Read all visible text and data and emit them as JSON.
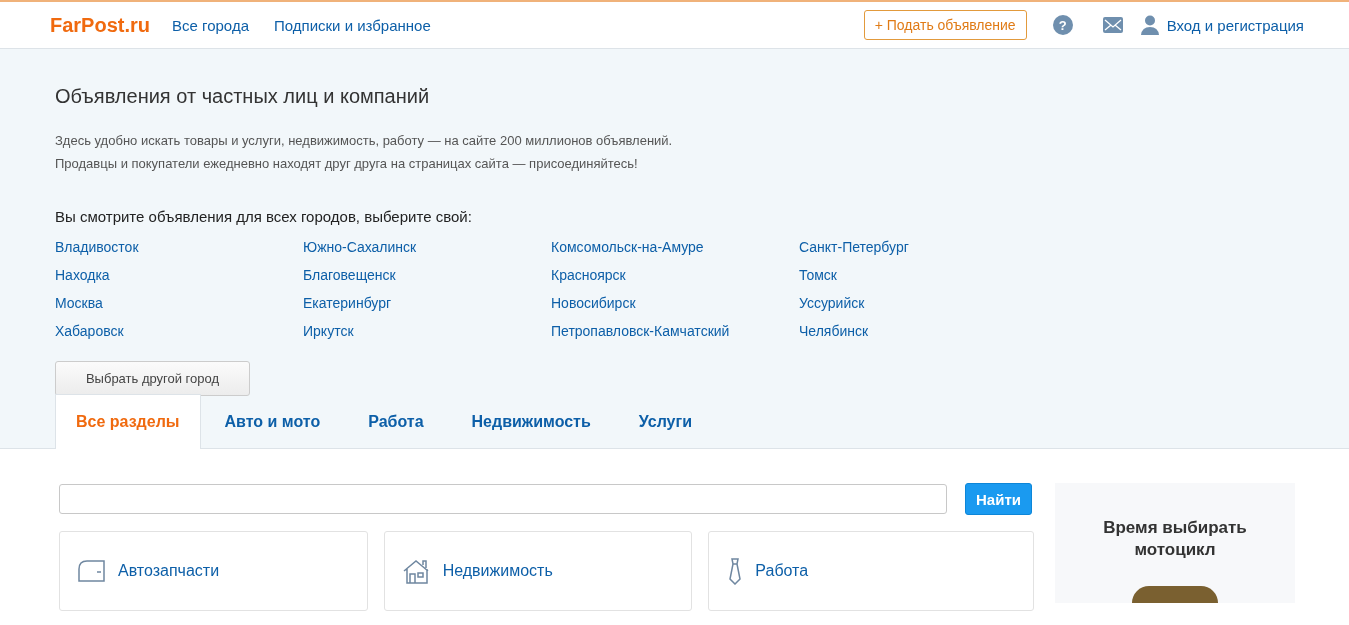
{
  "header": {
    "logo": "FarPost.ru",
    "links": [
      "Все города",
      "Подписки и избранное"
    ],
    "post_button": "+ Подать объявление",
    "help": "?",
    "login": "Вход и регистрация"
  },
  "hero": {
    "title": "Объявления от частных лиц и компаний",
    "lines": [
      "Здесь удобно искать товары и услуги, недвижимость, работу — на сайте 200 миллионов объявлений.",
      "Продавцы и покупатели ежедневно находят друг друга на страницах сайта — присоединяйтесь!"
    ],
    "prompt": "Вы смотрите объявления для всех городов, выберите свой:",
    "cities": [
      [
        "Владивосток",
        "Находка",
        "Москва",
        "Хабаровск"
      ],
      [
        "Южно-Сахалинск",
        "Благовещенск",
        "Екатеринбург",
        "Иркутск"
      ],
      [
        "Комсомольск-на-Амуре",
        "Красноярск",
        "Новосибирск",
        "Петропавловск-Камчатский"
      ],
      [
        "Санкт-Петербург",
        "Томск",
        "Уссурийск",
        "Челябинск"
      ]
    ],
    "other_city_button": "Выбрать другой город"
  },
  "tabs": [
    {
      "label": "Все разделы",
      "selected": true
    },
    {
      "label": "Авто и мото",
      "selected": false
    },
    {
      "label": "Работа",
      "selected": false
    },
    {
      "label": "Недвижимость",
      "selected": false
    },
    {
      "label": "Услуги",
      "selected": false
    }
  ],
  "search": {
    "button": "Найти"
  },
  "categories": [
    {
      "kind": "car-part",
      "label": "Автозапчасти"
    },
    {
      "kind": "house",
      "label": "Недвижимость"
    },
    {
      "kind": "tie",
      "label": "Работа"
    }
  ],
  "promo": {
    "title": "Время выбирать мотоцикл"
  }
}
